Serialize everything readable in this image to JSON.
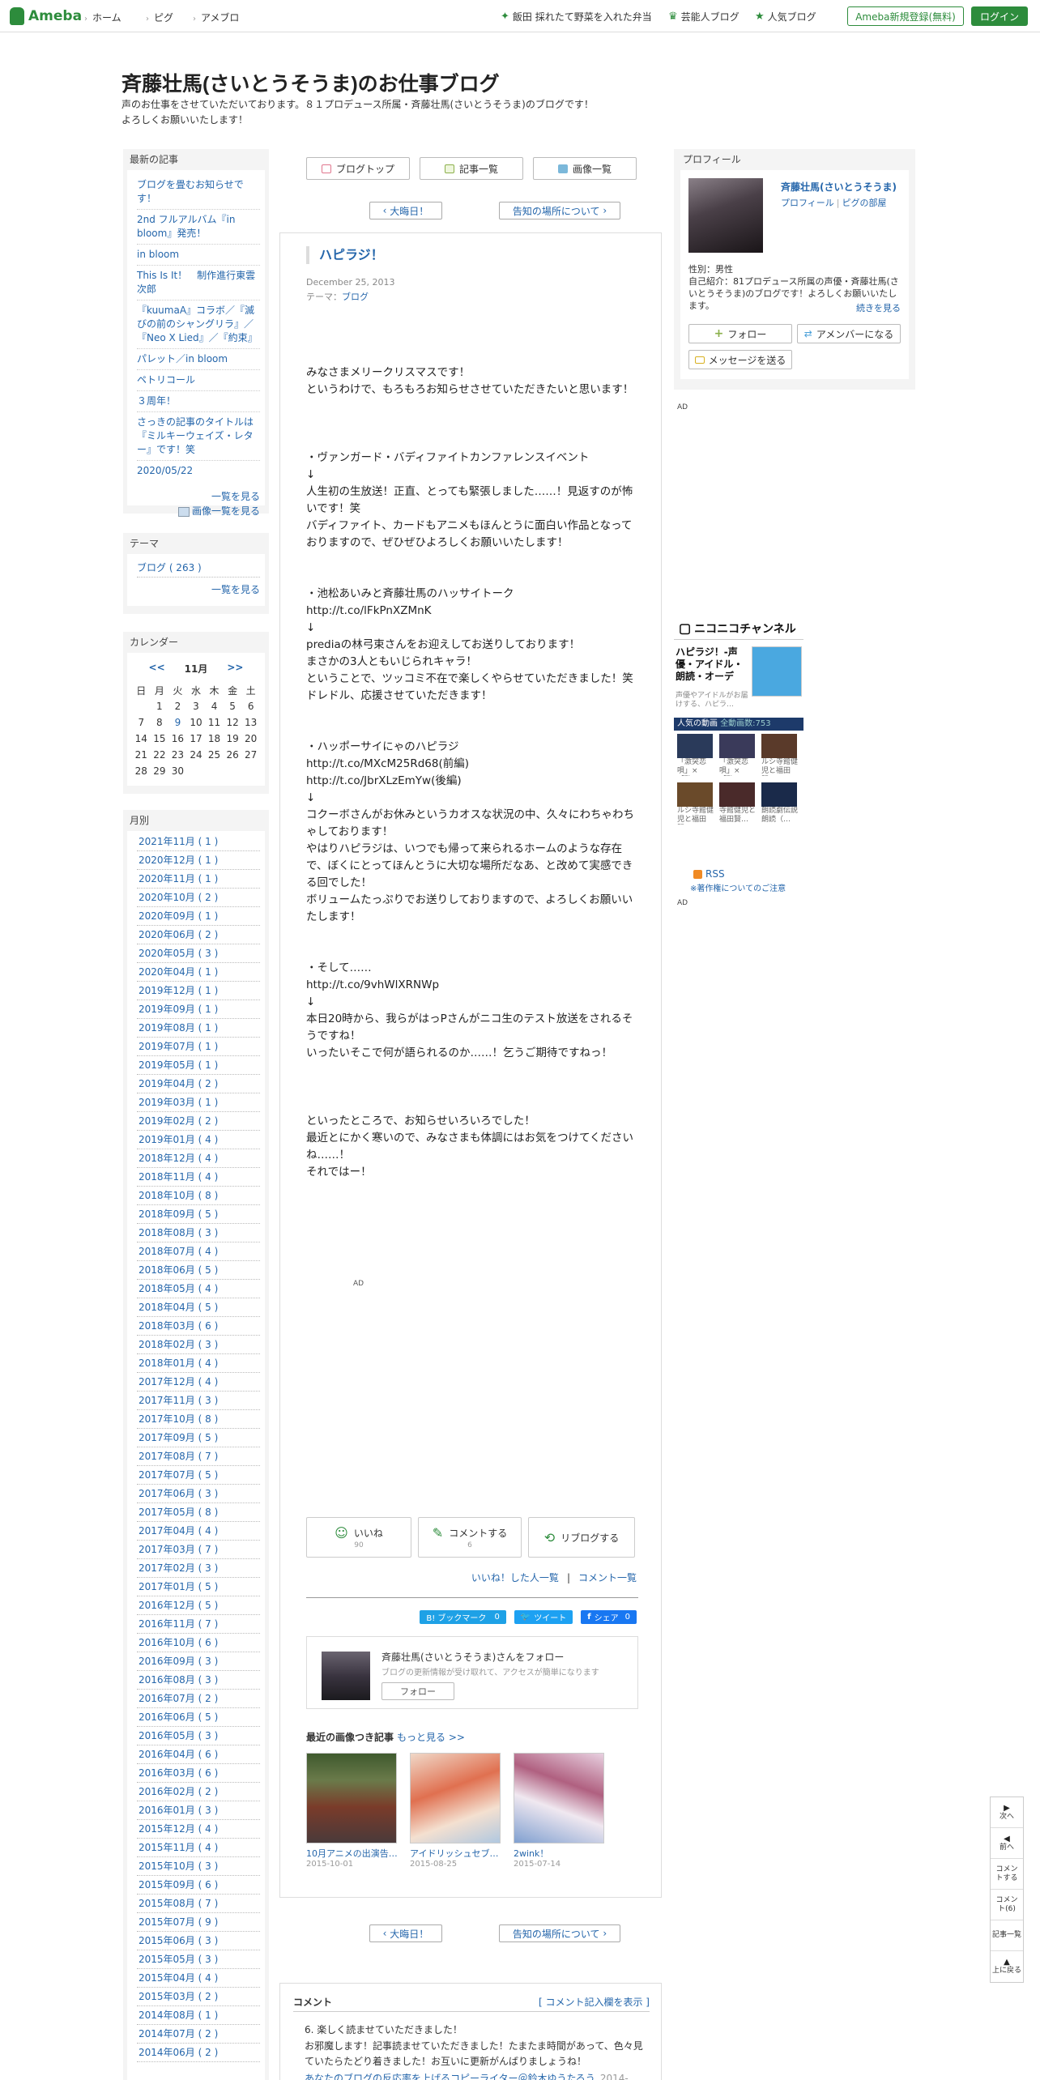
{
  "topbar": {
    "logo": "Ameba",
    "nav": [
      "ホーム",
      "ピグ",
      "アメブロ"
    ],
    "right_links": [
      "飯田 採れたて野菜を入れた弁当",
      "芸能人ブログ",
      "人気ブログ"
    ],
    "register": "Ameba新規登録(無料)",
    "login": "ログイン"
  },
  "header": {
    "title": "斉藤壮馬(さいとうそうま)のお仕事ブログ",
    "desc": "声のお仕事をさせていただいております。８１プロデュース所属・斉藤壮馬(さいとうそうま)のブログです！\nよろしくお願いいたします！"
  },
  "recent": {
    "head": "最新の記事",
    "items": [
      "ブログを畳むお知らせです！",
      "2nd フルアルバム『in bloom』発売！",
      "in bloom",
      "This Is It！　制作進行東雲次郎",
      "『kuumaA』コラボ／『滅びの前のシャングリラ』／『Neo X Lied』／『約束』",
      "パレット／in bloom",
      "ペトリコール",
      "３周年！",
      "さっきの記事のタイトルは『ミルキーウェイズ・レター』です！笑",
      "2020/05/22"
    ],
    "more": "一覧を見る",
    "more_images": "画像一覧を見る"
  },
  "theme": {
    "head": "テーマ",
    "item": "ブログ ( 263 )",
    "more": "一覧を見る"
  },
  "calendar": {
    "head": "カレンダー",
    "prev": "<<",
    "month": "11月",
    "next": ">>",
    "weekdays": [
      "日",
      "月",
      "火",
      "水",
      "木",
      "金",
      "土"
    ],
    "weeks": [
      [
        "",
        "1",
        "2",
        "3",
        "4",
        "5",
        "6"
      ],
      [
        "7",
        "8",
        "9",
        "10",
        "11",
        "12",
        "13"
      ],
      [
        "14",
        "15",
        "16",
        "17",
        "18",
        "19",
        "20"
      ],
      [
        "21",
        "22",
        "23",
        "24",
        "25",
        "26",
        "27"
      ],
      [
        "28",
        "29",
        "30",
        "",
        "",
        "",
        ""
      ]
    ]
  },
  "monthly": {
    "head": "月別",
    "items": [
      "2021年11月 ( 1 )",
      "2020年12月 ( 1 )",
      "2020年11月 ( 1 )",
      "2020年10月 ( 2 )",
      "2020年09月 ( 1 )",
      "2020年06月 ( 2 )",
      "2020年05月 ( 3 )",
      "2020年04月 ( 1 )",
      "2019年12月 ( 1 )",
      "2019年09月 ( 1 )",
      "2019年08月 ( 1 )",
      "2019年07月 ( 1 )",
      "2019年05月 ( 1 )",
      "2019年04月 ( 2 )",
      "2019年03月 ( 1 )",
      "2019年02月 ( 2 )",
      "2019年01月 ( 4 )",
      "2018年12月 ( 4 )",
      "2018年11月 ( 4 )",
      "2018年10月 ( 8 )",
      "2018年09月 ( 5 )",
      "2018年08月 ( 3 )",
      "2018年07月 ( 4 )",
      "2018年06月 ( 5 )",
      "2018年05月 ( 4 )",
      "2018年04月 ( 5 )",
      "2018年03月 ( 6 )",
      "2018年02月 ( 3 )",
      "2018年01月 ( 4 )",
      "2017年12月 ( 4 )",
      "2017年11月 ( 3 )",
      "2017年10月 ( 8 )",
      "2017年09月 ( 5 )",
      "2017年08月 ( 7 )",
      "2017年07月 ( 5 )",
      "2017年06月 ( 3 )",
      "2017年05月 ( 8 )",
      "2017年04月 ( 4 )",
      "2017年03月 ( 7 )",
      "2017年02月 ( 3 )",
      "2017年01月 ( 5 )",
      "2016年12月 ( 5 )",
      "2016年11月 ( 7 )",
      "2016年10月 ( 6 )",
      "2016年09月 ( 3 )",
      "2016年08月 ( 3 )",
      "2016年07月 ( 2 )",
      "2016年06月 ( 5 )",
      "2016年05月 ( 3 )",
      "2016年04月 ( 6 )",
      "2016年03月 ( 6 )",
      "2016年02月 ( 2 )",
      "2016年01月 ( 3 )",
      "2015年12月 ( 4 )",
      "2015年11月 ( 4 )",
      "2015年10月 ( 3 )",
      "2015年09月 ( 6 )",
      "2015年08月 ( 7 )",
      "2015年07月 ( 9 )",
      "2015年06月 ( 3 )",
      "2015年05月 ( 3 )",
      "2015年04月 ( 4 )",
      "2015年03月 ( 2 )",
      "2014年08月 ( 1 )",
      "2014年07月 ( 2 )",
      "2014年06月 ( 2 )"
    ]
  },
  "tabs": [
    "ブログトップ",
    "記事一覧",
    "画像一覧"
  ],
  "pager": {
    "prev": "大晦日！",
    "next": "告知の場所について"
  },
  "entry": {
    "title": "ハピラジ！",
    "date": "December 25, 2013",
    "theme_label": "テーマ：",
    "theme": "ブログ",
    "body": "みなさまメリークリスマスです！\nというわけで、もろもろお知らせさせていただきたいと思います！\n\n\n\n・ヴァンガード・バディファイトカンファレンスイベント\n↓\n人生初の生放送！正直、とっても緊張しました……！見返すのが怖いです！笑\nバディファイト、カードもアニメもほんとうに面白い作品となっておりますので、ぜひぜひよろしくお願いいたします！\n\n\n・池松あいみと斉藤壮馬のハッサイトーク\nhttp://t.co/lFkPnXZMnK\n↓\nprediaの林弓束さんをお迎えしてお送りしております！\nまさかの3人ともいじられキャラ！\nということで、ツッコミ不在で楽しくやらせていただきました！笑\nドレドル、応援させていただきます！\n\n\n・ハッポーサイにゃのハピラジ\nhttp://t.co/MXcM25Rd68(前編)\nhttp://t.co/JbrXLzEmYw(後編)\n↓\nコクーボさんがお休みというカオスな状況の中、久々にわちゃわちゃしております！\nやはりハピラジは、いつでも帰って来られるホームのような存在で、ぼくにとってほんとうに大切な場所だなあ、と改めて実感できる回でした！\nボリュームたっぷりでお送りしておりますので、よろしくお願いいたします！\n\n\n・そして……\nhttp://t.co/9vhWlXRNWp\n↓\n本日20時から、我らがはっPさんがニコ生のテスト放送をされるそうですね！\nいったいそこで何が語られるのか……！乞うご期待ですねっ！\n\n\n\nといったところで、お知らせいろいろでした！\n最近とにかく寒いので、みなさまも体調にはお気をつけてくださいね……！\nそれではー！"
  },
  "ad_label": "AD",
  "actions": {
    "like": "いいね",
    "like_count": "90",
    "comment": "コメントする",
    "comment_count": "6",
    "reblog": "リブログする",
    "liked_people": "いいね！した人一覧",
    "sep": "|",
    "comment_list": "コメント一覧"
  },
  "share": {
    "hatena": "B! ブックマーク",
    "hatena_count": "0",
    "tweet": "ツイート",
    "fb": "シェア",
    "fb_count": "0"
  },
  "follow": {
    "name": "斉藤壮馬(さいとうそうま)さんをフォロー",
    "sub": "ブログの更新情報が受け取れて、アクセスが簡単になります",
    "button": "フォロー"
  },
  "recent_images": {
    "head": "最近の画像つき記事",
    "more": "もっと見る >>",
    "items": [
      {
        "title": "10月アニメの出演告…",
        "date": "2015-10-01"
      },
      {
        "title": "アイドリッシュセブ…",
        "date": "2015-08-25"
      },
      {
        "title": "2wink！",
        "date": "2015-07-14"
      }
    ]
  },
  "comments": {
    "head": "コメント",
    "form": "[ コメント記入欄を表示 ]",
    "c1": "6. 楽しく読ませていただきました！",
    "c2": "お邪魔します！記事読ませていただきました！たまたま時間があって、色々見ていたらたどり着きました！お互いに更新がんばりましょうね！",
    "c3": "あなたのブログの反応率を上げるコピーライター＠鈴木ゆうたろう",
    "c3_date": "2014-"
  },
  "profile": {
    "head": "プロフィール",
    "name": "斉藤壮馬(さいとうそうま)",
    "link1": "プロフィール",
    "link_sep": "|",
    "link2": "ピグの部屋",
    "sex": "性別：男性",
    "intro": "自己紹介：81プロデュース所属の声優・斉藤壮馬(さいとうそうま)のブログです！よろしくお願いいたします。",
    "more": "続きを見る",
    "follow": "フォロー",
    "amember": "アメンバーになる",
    "message": "メッセージを送る"
  },
  "nico": {
    "logo": "ニコニコチャンネル",
    "title": "ハピラジ！-声優・アイドル・朗読・オーディ…",
    "sub": "声優やアイドルがお届けする、ハピラ…",
    "bar_label": "人気の動画",
    "bar_count": "全動画数:753",
    "videos": [
      "「激突恋唄」×「酔…",
      "「激突恋唄」×「酔…",
      "ルシ寺館健児と福田賢…",
      "ルシ寺館健児と福田賢…",
      "寺館健児と福田賢…",
      "朗読劇伝説　朗読（…"
    ]
  },
  "rss": {
    "label": "RSS",
    "note": "※著作権についてのご注意"
  },
  "floatnav": [
    "次へ",
    "前へ",
    "コメントする",
    "コメント(6)",
    "記事一覧",
    "上に戻る"
  ]
}
